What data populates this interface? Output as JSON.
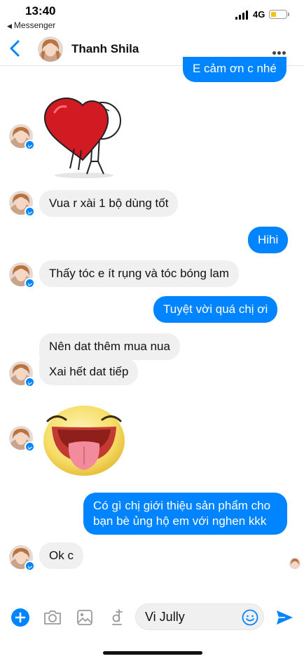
{
  "status_bar": {
    "time": "13:40",
    "back_app": "Messenger",
    "network": "4G"
  },
  "header": {
    "contact_name": "Thanh Shila"
  },
  "messages": [
    {
      "side": "out",
      "text": "E cảm ơn c nhé"
    },
    {
      "side": "in",
      "type": "sticker",
      "icon": "heart-character-sticker"
    },
    {
      "side": "in",
      "text": "Vua r xài 1 bộ dùng tốt"
    },
    {
      "side": "out",
      "text": "Hihi"
    },
    {
      "side": "in",
      "text": "Thấy tóc e ít rụng và tóc bóng lam"
    },
    {
      "side": "out",
      "text": "Tuyệt vời quá chị ơi"
    },
    {
      "side": "in",
      "text": "Nên dat thêm mua nua"
    },
    {
      "side": "in",
      "text": "Xai hết dat tiếp"
    },
    {
      "side": "in",
      "type": "sticker",
      "icon": "tongue-out-emoji-sticker"
    },
    {
      "side": "out",
      "text": "Có gì chị giới thiệu sản phẩm cho bạn bè ủng hộ em với nghen kkk"
    },
    {
      "side": "in",
      "text": "Ok c"
    }
  ],
  "composer": {
    "input_value": "Vi Jully",
    "icons": [
      "plus-icon",
      "camera-icon",
      "image-icon",
      "dong-icon",
      "emoji-icon",
      "send-icon"
    ]
  },
  "colors": {
    "accent": "#0084ff",
    "incoming_bubble": "#f1f0f0",
    "outgoing_text": "#ffffff"
  }
}
